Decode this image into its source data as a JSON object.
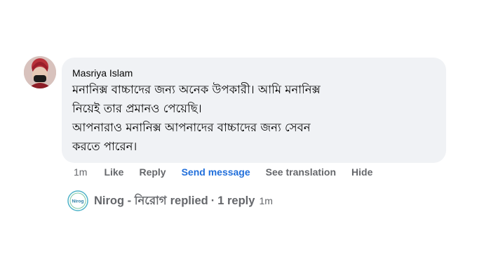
{
  "comment": {
    "author": "Masriya Islam",
    "avatar_icon": "profile-photo-avatar",
    "text_lines": [
      "মনানিক্স বাচ্চাদের জন্য অনেক উপকারী। আমি মনানিক্স",
      "নিয়েই তার প্রমানও পেয়েছি।",
      "আপনারাও মনানিক্স আপনাদের বাচ্চাদের জন্য সেবন",
      "করতে পারেন।"
    ],
    "bubble_color": "#f0f2f5"
  },
  "actions": {
    "time": "1m",
    "like": "Like",
    "reply": "Reply",
    "send_message": "Send message",
    "see_translation": "See translation",
    "hide": "Hide",
    "accent_color": "#216fdb",
    "muted_color": "#65676b"
  },
  "reply_summary": {
    "avatar_icon": "nirog-logo-icon",
    "avatar_logo_text": "Nirog",
    "page_name": "Nirog - নিরোগ",
    "replied_label": "replied",
    "separator": "·",
    "reply_count": "1 reply",
    "time": "1m"
  }
}
